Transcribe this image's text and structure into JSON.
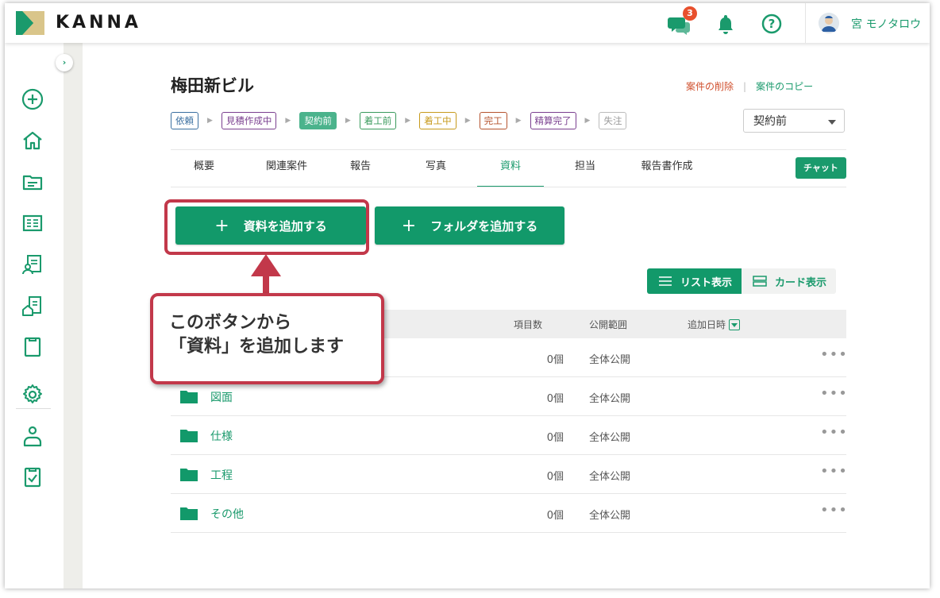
{
  "header": {
    "logo_text": "KANNA",
    "notification_count": "3",
    "user_name": "宮 モノタロウ"
  },
  "project": {
    "title": "梅田新ビル",
    "delete_link": "案件の削除",
    "link_separator": "|",
    "copy_link": "案件のコピー"
  },
  "statuses": [
    {
      "label": "依頼",
      "color": "#3a6fa0"
    },
    {
      "label": "見積作成中",
      "color": "#7a3f8f"
    },
    {
      "label": "契約前",
      "color": "#4bb38c",
      "active": true
    },
    {
      "label": "着工前",
      "color": "#3a9a5c"
    },
    {
      "label": "着工中",
      "color": "#c79a1c"
    },
    {
      "label": "完工",
      "color": "#b5532e"
    },
    {
      "label": "精算完了",
      "color": "#7a3f8f"
    },
    {
      "label": "失注",
      "color": "#999999"
    }
  ],
  "status_select": {
    "value": "契約前"
  },
  "tabs": [
    "概要",
    "関連案件",
    "報告",
    "写真",
    "資料",
    "担当",
    "報告書作成"
  ],
  "active_tab": "資料",
  "chat_button": "チャット",
  "actions": {
    "add_document": "資料を追加する",
    "add_folder": "フォルダを追加する"
  },
  "view_toggle": {
    "list": "リスト表示",
    "card": "カード表示"
  },
  "table": {
    "columns": [
      "項目数",
      "公開範囲",
      "追加日時"
    ],
    "rows": [
      {
        "name": "",
        "count": "0個",
        "scope": "全体公開"
      },
      {
        "name": "図面",
        "count": "0個",
        "scope": "全体公開"
      },
      {
        "name": "仕様",
        "count": "0個",
        "scope": "全体公開"
      },
      {
        "name": "工程",
        "count": "0個",
        "scope": "全体公開"
      },
      {
        "name": "その他",
        "count": "0個",
        "scope": "全体公開"
      }
    ]
  },
  "callout": {
    "line1": "このボタンから",
    "line2": "「資料」を追加します"
  },
  "colors": {
    "accent": "#12996a",
    "highlight": "#c2384a",
    "danger_link": "#d0502e"
  }
}
